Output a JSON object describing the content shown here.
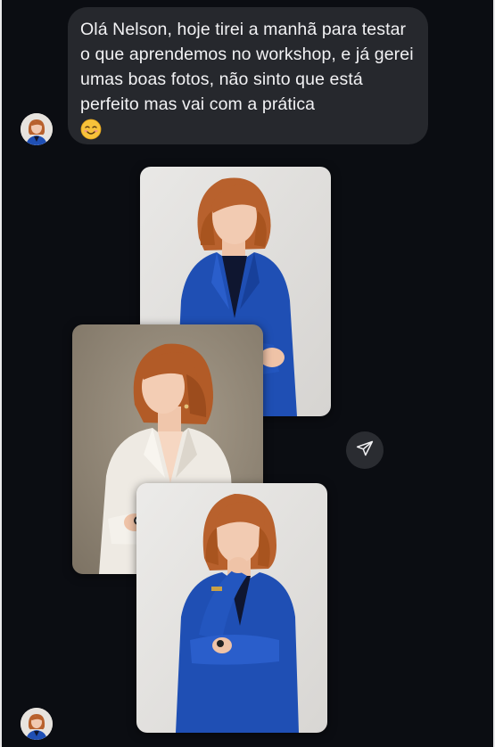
{
  "message": {
    "text": "Olá Nelson, hoje tirei a manhã para testar o que aprendemos no workshop, e já gerei umas boas fotos, não sinto que está perfeito mas vai com a prática",
    "emoji": "smiling-face-with-blush-emoji"
  },
  "photos": [
    {
      "subject": "woman-blue-blazer-arms-crossed"
    },
    {
      "subject": "woman-white-blazer-profile"
    },
    {
      "subject": "woman-blue-blazer-hand-on-chin"
    }
  ],
  "actions": {
    "share_icon": "paper-plane-icon"
  },
  "colors": {
    "background": "#0b0d12",
    "bubble": "#26282d",
    "text": "#f2f2f4",
    "blazer_blue": "#1f4fb4",
    "blazer_white": "#eeeae3",
    "hair": "#b8612d"
  }
}
